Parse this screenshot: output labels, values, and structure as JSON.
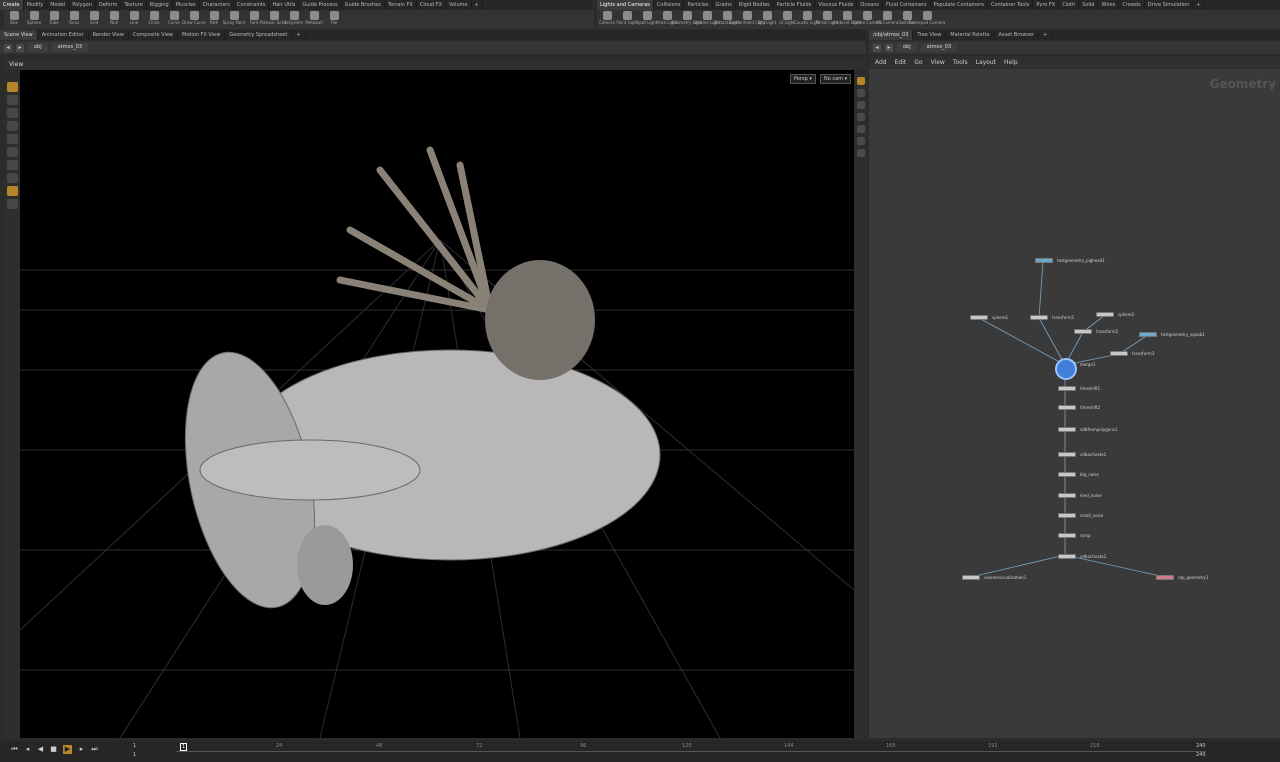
{
  "shelf_left": {
    "tabs": [
      "Create",
      "Modify",
      "Model",
      "Polygon",
      "Deform",
      "Texture",
      "Rigging",
      "Muscles",
      "Characters",
      "Constraints",
      "Hair Utils",
      "Guide Process",
      "Guide Brushes",
      "Terrain FX",
      "Cloud FX",
      "Volume"
    ],
    "active": 0
  },
  "shelf_right": {
    "tabs": [
      "Lights and Cameras",
      "Collisions",
      "Particles",
      "Grains",
      "Rigid Bodies",
      "Particle Fluids",
      "Viscous Fluids",
      "Oceans",
      "Fluid Containers",
      "Populate Containers",
      "Container Tools",
      "Pyro FX",
      "Cloth",
      "Solid",
      "Wires",
      "Crowds",
      "Drive Simulation"
    ],
    "active": 0
  },
  "tools_left": [
    "Box",
    "Sphere",
    "Tube",
    "Torus",
    "Grid",
    "Null",
    "Line",
    "Circle",
    "Curve",
    "Draw Curve",
    "Path",
    "Spray Paint",
    "Font",
    "Platonic Solids",
    "L-System",
    "Metaball",
    "File"
  ],
  "tools_right": [
    "Camera",
    "Point Light",
    "Spot Light",
    "Area Light",
    "Geometry Light",
    "Volume Light",
    "Distant Light",
    "Environment Light",
    "Sky Light",
    "GI Light",
    "Caustic Light",
    "Portal Light",
    "Ambient Light",
    "Stereo Camera",
    "VR Camera",
    "Switcher",
    "Gamepad Camera"
  ],
  "left_panes": [
    "Scene View",
    "Animation Editor",
    "Render View",
    "Composite View",
    "Motion FX View",
    "Geometry Spreadsheet"
  ],
  "right_panes": [
    "/obj/atmos_03",
    "Tree View",
    "Material Palette",
    "Asset Browser"
  ],
  "left_path": [
    "obj",
    "atmos_03"
  ],
  "right_path": [
    "obj",
    "atmos_03"
  ],
  "viewport": {
    "title": "View",
    "camera_menu": "Persp ▾",
    "cam_menu": "No cam ▾"
  },
  "network": {
    "menu": [
      "Add",
      "Edit",
      "Go",
      "View",
      "Tools",
      "Layout",
      "Help"
    ],
    "context_label": "Geometry"
  },
  "nodes": [
    {
      "label": "testgeometry_pighead1"
    },
    {
      "label": "sphere1"
    },
    {
      "label": "transform1"
    },
    {
      "label": "sphere2"
    },
    {
      "label": "transform2"
    },
    {
      "label": "testgeometry_squab1"
    },
    {
      "label": "transform3"
    },
    {
      "label": "merge1"
    },
    {
      "label": "timeshift1"
    },
    {
      "label": "timeshift2"
    },
    {
      "label": "vdbfrompolygons1"
    },
    {
      "label": "vdbactivate1"
    },
    {
      "label": "big_noise"
    },
    {
      "label": "med_noise"
    },
    {
      "label": "small_noise"
    },
    {
      "label": "ramp"
    },
    {
      "label": "vdbactivate2"
    },
    {
      "label": "volumevisualization1"
    },
    {
      "label": "rop_geometry1"
    }
  ],
  "timeline": {
    "current": "1",
    "start": "1",
    "end": "240",
    "end2": "240",
    "ticks": [
      "24",
      "48",
      "72",
      "96",
      "120",
      "144",
      "168",
      "192",
      "216"
    ],
    "left_val": "1",
    "left_val2": "1"
  }
}
